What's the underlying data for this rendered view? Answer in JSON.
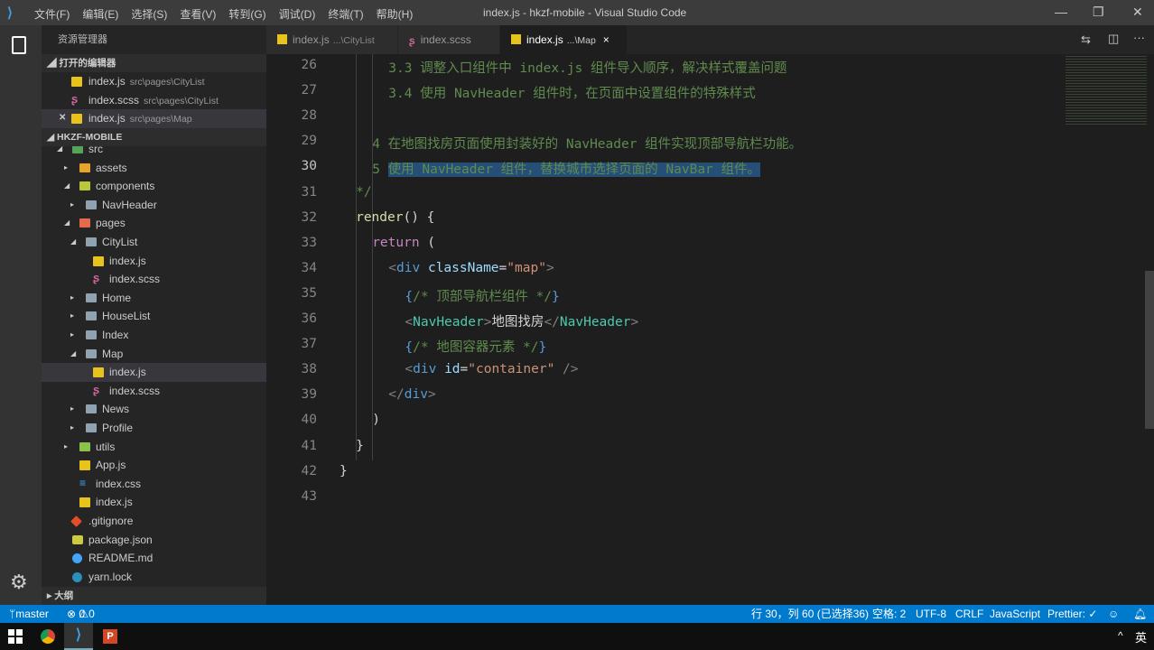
{
  "window": {
    "title": "index.js - hkzf-mobile - Visual Studio Code",
    "menu": [
      "文件(F)",
      "编辑(E)",
      "选择(S)",
      "查看(V)",
      "转到(G)",
      "调试(D)",
      "终端(T)",
      "帮助(H)"
    ]
  },
  "sidebar": {
    "title": "资源管理器",
    "open_editors_label": "打开的编辑器",
    "project_label": "HKZF-MOBILE",
    "outline_label": "大纲",
    "open_editors": [
      {
        "name": "index.js",
        "path": "src\\pages\\CityList",
        "icon": "js"
      },
      {
        "name": "index.scss",
        "path": "src\\pages\\CityList",
        "icon": "scss"
      },
      {
        "name": "index.js",
        "path": "src\\pages\\Map",
        "icon": "js",
        "active": true
      }
    ],
    "tree": [
      {
        "name": "src",
        "depth": 0,
        "icon": "src",
        "arrow": "open"
      },
      {
        "name": "assets",
        "depth": 1,
        "icon": "assets",
        "arrow": "closed"
      },
      {
        "name": "components",
        "depth": 1,
        "icon": "components",
        "arrow": "open"
      },
      {
        "name": "NavHeader",
        "depth": 2,
        "icon": "folder",
        "arrow": "closed"
      },
      {
        "name": "pages",
        "depth": 1,
        "icon": "pages",
        "arrow": "open"
      },
      {
        "name": "CityList",
        "depth": 2,
        "icon": "folder",
        "arrow": "open"
      },
      {
        "name": "index.js",
        "depth": 3,
        "icon": "js"
      },
      {
        "name": "index.scss",
        "depth": 3,
        "icon": "scss"
      },
      {
        "name": "Home",
        "depth": 2,
        "icon": "folder",
        "arrow": "closed"
      },
      {
        "name": "HouseList",
        "depth": 2,
        "icon": "folder",
        "arrow": "closed"
      },
      {
        "name": "Index",
        "depth": 2,
        "icon": "folder",
        "arrow": "closed"
      },
      {
        "name": "Map",
        "depth": 2,
        "icon": "folder",
        "arrow": "open"
      },
      {
        "name": "index.js",
        "depth": 3,
        "icon": "js",
        "selected": true
      },
      {
        "name": "index.scss",
        "depth": 3,
        "icon": "scss"
      },
      {
        "name": "News",
        "depth": 2,
        "icon": "folder",
        "arrow": "closed"
      },
      {
        "name": "Profile",
        "depth": 2,
        "icon": "folder",
        "arrow": "closed"
      },
      {
        "name": "utils",
        "depth": 1,
        "icon": "utils",
        "arrow": "closed"
      },
      {
        "name": "App.js",
        "depth": 1,
        "icon": "js"
      },
      {
        "name": "index.css",
        "depth": 1,
        "icon": "css"
      },
      {
        "name": "index.js",
        "depth": 1,
        "icon": "js"
      },
      {
        "name": ".gitignore",
        "depth": 0,
        "icon": "git"
      },
      {
        "name": "package.json",
        "depth": 0,
        "icon": "json"
      },
      {
        "name": "README.md",
        "depth": 0,
        "icon": "md"
      },
      {
        "name": "yarn.lock",
        "depth": 0,
        "icon": "yarn"
      }
    ]
  },
  "tabs": [
    {
      "name": "index.js",
      "sub": "...\\CityList",
      "icon": "js"
    },
    {
      "name": "index.scss",
      "sub": "",
      "icon": "scss"
    },
    {
      "name": "index.js",
      "sub": "...\\Map",
      "icon": "js",
      "active": true,
      "close": "×"
    }
  ],
  "editor": {
    "current_line": 30,
    "lines": [
      {
        "n": 26,
        "indent": 6,
        "tokens": [
          [
            "3.3 调整入口组件中 index.js 组件导入顺序，解决样式覆盖问题",
            "cmt"
          ]
        ]
      },
      {
        "n": 27,
        "indent": 6,
        "tokens": [
          [
            "3.4 使用 NavHeader 组件时，在页面中设置组件的特殊样式",
            "cmt"
          ]
        ]
      },
      {
        "n": 28,
        "indent": 0,
        "tokens": []
      },
      {
        "n": 29,
        "indent": 4,
        "tokens": [
          [
            "4 ",
            "num"
          ],
          [
            "在地图找房页面使用封装好的 NavHeader 组件实现顶部导航栏功能。",
            "cmt"
          ]
        ]
      },
      {
        "n": 30,
        "indent": 4,
        "tokens": [
          [
            "5 ",
            "num"
          ],
          [
            "使用 NavHeader 组件，替换城市选择页面的 NavBar 组件。",
            "cmt sel"
          ]
        ]
      },
      {
        "n": 31,
        "indent": 2,
        "tokens": [
          [
            "*/",
            "cmt"
          ]
        ]
      },
      {
        "n": 32,
        "indent": 2,
        "tokens": [
          [
            "render",
            "fn"
          ],
          [
            "() {",
            "pl"
          ]
        ]
      },
      {
        "n": 33,
        "indent": 4,
        "tokens": [
          [
            "return",
            "kw"
          ],
          [
            " (",
            "pl"
          ]
        ]
      },
      {
        "n": 34,
        "indent": 6,
        "tokens": [
          [
            "<",
            "br"
          ],
          [
            "div",
            "tag"
          ],
          [
            " ",
            "pl"
          ],
          [
            "className",
            "attr"
          ],
          [
            "=",
            "pl"
          ],
          [
            "\"map\"",
            "str"
          ],
          [
            ">",
            "br"
          ]
        ]
      },
      {
        "n": 35,
        "indent": 8,
        "tokens": [
          [
            "{",
            "tag"
          ],
          [
            "/* 顶部导航栏组件 */",
            "cmt"
          ],
          [
            "}",
            "tag"
          ]
        ]
      },
      {
        "n": 36,
        "indent": 8,
        "tokens": [
          [
            "<",
            "br"
          ],
          [
            "NavHeader",
            "comp"
          ],
          [
            ">",
            "br"
          ],
          [
            "地图找房",
            "pl"
          ],
          [
            "</",
            "br"
          ],
          [
            "NavHeader",
            "comp"
          ],
          [
            ">",
            "br"
          ]
        ]
      },
      {
        "n": 37,
        "indent": 8,
        "tokens": [
          [
            "{",
            "tag"
          ],
          [
            "/* 地图容器元素 */",
            "cmt"
          ],
          [
            "}",
            "tag"
          ]
        ]
      },
      {
        "n": 38,
        "indent": 8,
        "tokens": [
          [
            "<",
            "br"
          ],
          [
            "div",
            "tag"
          ],
          [
            " ",
            "pl"
          ],
          [
            "id",
            "attr"
          ],
          [
            "=",
            "pl"
          ],
          [
            "\"container\"",
            "str"
          ],
          [
            " />",
            "br"
          ]
        ]
      },
      {
        "n": 39,
        "indent": 6,
        "tokens": [
          [
            "</",
            "br"
          ],
          [
            "div",
            "tag"
          ],
          [
            ">",
            "br"
          ]
        ]
      },
      {
        "n": 40,
        "indent": 4,
        "tokens": [
          [
            ")",
            "pl"
          ]
        ]
      },
      {
        "n": 41,
        "indent": 2,
        "tokens": [
          [
            "}",
            "pl"
          ]
        ]
      },
      {
        "n": 42,
        "indent": 0,
        "tokens": [
          [
            "}",
            "pl"
          ]
        ]
      },
      {
        "n": 43,
        "indent": 0,
        "tokens": []
      }
    ]
  },
  "statusbar": {
    "branch": "master",
    "errors": "0",
    "warnings": "0",
    "position": "行 30，列 60 (已选择36)",
    "spaces": "空格: 2",
    "encoding": "UTF-8",
    "eol": "CRLF",
    "language": "JavaScript",
    "formatter": "Prettier: ✓"
  },
  "taskbar": {
    "ime": "英"
  },
  "colors": {
    "statusbar": "#007acc",
    "selection": "#264f78",
    "comment": "#608b4e"
  }
}
